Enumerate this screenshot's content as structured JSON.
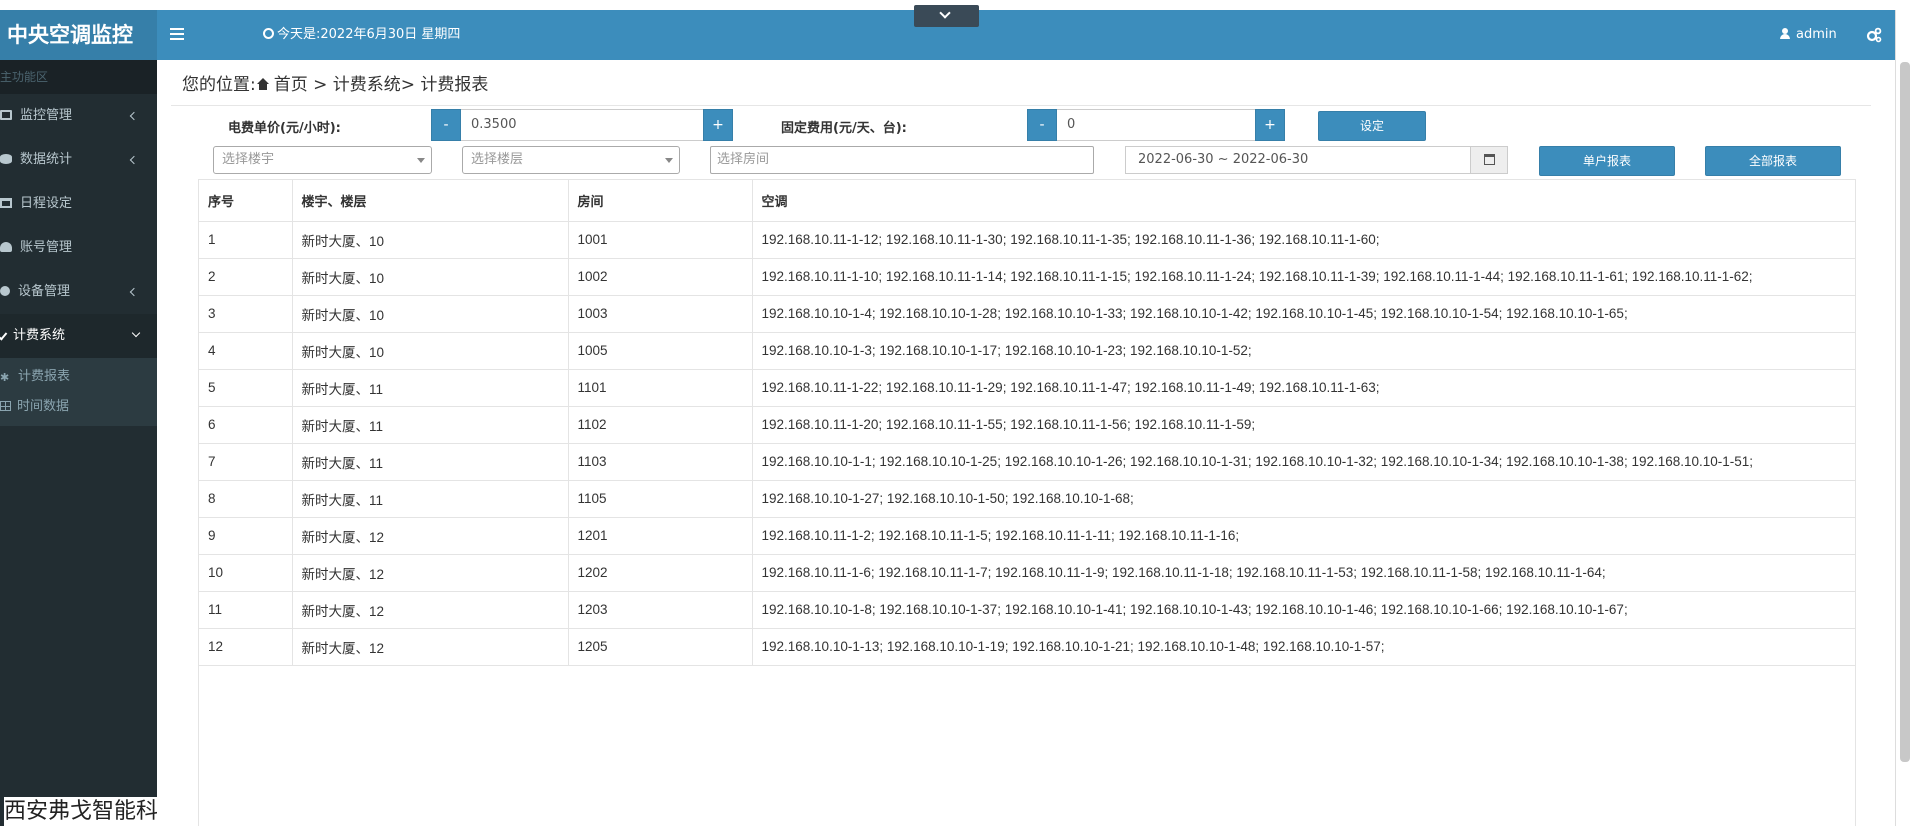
{
  "app": {
    "title": "中央空调监控"
  },
  "header": {
    "date_text": "今天是:2022年6月30日 星期四",
    "user_name": "admin"
  },
  "sidebar": {
    "section_label": "主功能区",
    "items": [
      {
        "label": "监控管理",
        "icon": "monitor-icon",
        "has_arrow": true
      },
      {
        "label": "数据统计",
        "icon": "database-icon",
        "has_arrow": true
      },
      {
        "label": "日程设定",
        "icon": "calendar-icon",
        "has_arrow": false
      },
      {
        "label": "账号管理",
        "icon": "user-icon",
        "has_arrow": false
      },
      {
        "label": "设备管理",
        "icon": "gear-icon",
        "has_arrow": true
      },
      {
        "label": "计费系统",
        "icon": "check-icon",
        "has_arrow": true,
        "expanded": true
      }
    ],
    "subitems": [
      {
        "label": "计费报表",
        "icon": "star-icon"
      },
      {
        "label": "时间数据",
        "icon": "grid-icon"
      }
    ],
    "footer_text": "西安弗戈智能科"
  },
  "breadcrumb": {
    "prefix": "您的位置:",
    "path": "首页 > 计费系统> 计费报表"
  },
  "form": {
    "unit_price_label": "电费单价(元/小时):",
    "unit_price_value": "0.3500",
    "fixed_fee_label": "固定费用(元/天、台):",
    "fixed_fee_value": "0",
    "minus": "-",
    "plus": "+",
    "set_button": "设定",
    "building_placeholder": "选择楼宇",
    "floor_placeholder": "选择楼层",
    "room_placeholder": "选择房间",
    "date_range": "2022-06-30 ~ 2022-06-30",
    "single_report_button": "单户报表",
    "all_report_button": "全部报表"
  },
  "table": {
    "headers": [
      "序号",
      "楼宇、楼层",
      "房间",
      "空调"
    ],
    "rows": [
      [
        "1",
        "新时大厦、10",
        "1001",
        "192.168.10.11-1-12; 192.168.10.11-1-30; 192.168.10.11-1-35; 192.168.10.11-1-36; 192.168.10.11-1-60;"
      ],
      [
        "2",
        "新时大厦、10",
        "1002",
        "192.168.10.11-1-10; 192.168.10.11-1-14; 192.168.10.11-1-15; 192.168.10.11-1-24; 192.168.10.11-1-39; 192.168.10.11-1-44; 192.168.10.11-1-61; 192.168.10.11-1-62;"
      ],
      [
        "3",
        "新时大厦、10",
        "1003",
        "192.168.10.10-1-4; 192.168.10.10-1-28; 192.168.10.10-1-33; 192.168.10.10-1-42; 192.168.10.10-1-45; 192.168.10.10-1-54; 192.168.10.10-1-65;"
      ],
      [
        "4",
        "新时大厦、10",
        "1005",
        "192.168.10.10-1-3; 192.168.10.10-1-17; 192.168.10.10-1-23; 192.168.10.10-1-52;"
      ],
      [
        "5",
        "新时大厦、11",
        "1101",
        "192.168.10.11-1-22; 192.168.10.11-1-29; 192.168.10.11-1-47; 192.168.10.11-1-49; 192.168.10.11-1-63;"
      ],
      [
        "6",
        "新时大厦、11",
        "1102",
        "192.168.10.11-1-20; 192.168.10.11-1-55; 192.168.10.11-1-56; 192.168.10.11-1-59;"
      ],
      [
        "7",
        "新时大厦、11",
        "1103",
        "192.168.10.10-1-1; 192.168.10.10-1-25; 192.168.10.10-1-26; 192.168.10.10-1-31; 192.168.10.10-1-32; 192.168.10.10-1-34; 192.168.10.10-1-38; 192.168.10.10-1-51;"
      ],
      [
        "8",
        "新时大厦、11",
        "1105",
        "192.168.10.10-1-27; 192.168.10.10-1-50; 192.168.10.10-1-68;"
      ],
      [
        "9",
        "新时大厦、12",
        "1201",
        "192.168.10.11-1-2; 192.168.10.11-1-5; 192.168.10.11-1-11; 192.168.10.11-1-16;"
      ],
      [
        "10",
        "新时大厦、12",
        "1202",
        "192.168.10.11-1-6; 192.168.10.11-1-7; 192.168.10.11-1-9; 192.168.10.11-1-18; 192.168.10.11-1-53; 192.168.10.11-1-58; 192.168.10.11-1-64;"
      ],
      [
        "11",
        "新时大厦、12",
        "1203",
        "192.168.10.10-1-8; 192.168.10.10-1-37; 192.168.10.10-1-41; 192.168.10.10-1-43; 192.168.10.10-1-46; 192.168.10.10-1-66; 192.168.10.10-1-67;"
      ],
      [
        "12",
        "新时大厦、12",
        "1205",
        "192.168.10.10-1-13; 192.168.10.10-1-19; 192.168.10.10-1-21; 192.168.10.10-1-48; 192.168.10.10-1-57;"
      ]
    ]
  },
  "colors": {
    "header_bg": "#3c8dbc",
    "logo_bg": "#367fa9",
    "sidebar_bg": "#222d32",
    "button_primary": "#3c8dbc"
  }
}
